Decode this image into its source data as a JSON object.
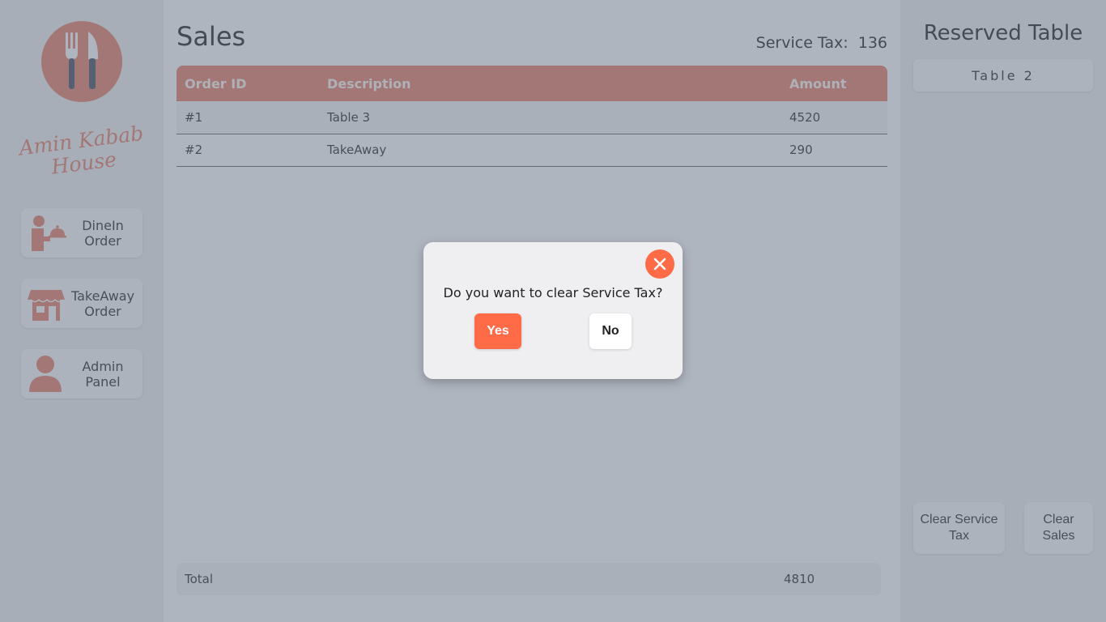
{
  "sidebar": {
    "brand": "Amin Kabab House",
    "nav": [
      {
        "label": "DineIn Order",
        "icon": "waiter-icon"
      },
      {
        "label": "TakeAway Order",
        "icon": "store-icon"
      },
      {
        "label": "Admin Panel",
        "icon": "person-icon"
      }
    ]
  },
  "main": {
    "title": "Sales",
    "service_tax_label": "Service Tax:",
    "service_tax_value": "136",
    "table": {
      "columns": [
        "Order ID",
        "Description",
        "Amount"
      ],
      "rows": [
        {
          "id": "#1",
          "description": "Table 3",
          "amount": "4520"
        },
        {
          "id": "#2",
          "description": "TakeAway",
          "amount": "290"
        }
      ]
    },
    "total_label": "Total",
    "total_value": "4810"
  },
  "right_panel": {
    "title": "Reserved Table",
    "reserved": [
      "Table 2"
    ],
    "clear_service_tax": "Clear Service Tax",
    "clear_sales": "Clear Sales"
  },
  "dialog": {
    "message": "Do you want to clear Service Tax?",
    "yes_label": "Yes",
    "no_label": "No"
  },
  "colors": {
    "accent": "#e5836c",
    "close_button": "#ff6a47",
    "yes_button": "#ff6a47"
  }
}
